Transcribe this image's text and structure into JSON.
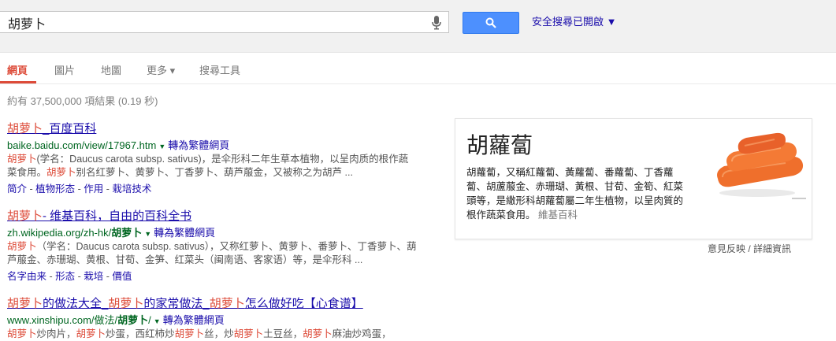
{
  "search": {
    "query": "胡萝卜",
    "button_icon": "search-icon",
    "mic_icon": "microphone-icon"
  },
  "safesearch": {
    "label": "安全搜尋已開啟 ▼"
  },
  "tabs": [
    {
      "label": "網頁",
      "active": true
    },
    {
      "label": "圖片"
    },
    {
      "label": "地圖"
    },
    {
      "label": "更多 ▾"
    },
    {
      "label": "搜尋工具"
    }
  ],
  "stats": "約有 37,500,000 項結果 (0.19 秒)",
  "results": [
    {
      "title_hl": "胡萝卜",
      "title_rest": "_百度百科",
      "url": "baike.baidu.com/view/17967.htm",
      "translate": "轉為繁體網頁",
      "snippet": [
        {
          "hl": "胡萝卜"
        },
        {
          "t": "(学名：Daucus carota subsp. sativus)，是伞形科二年生草本植物，以呈肉质的根作蔬菜食用。"
        },
        {
          "hl": "胡萝卜"
        },
        {
          "t": "别名红萝卜、黄萝卜、丁香萝卜、葫芦菔金，又被称之为胡芦 ..."
        }
      ],
      "links": [
        "简介",
        "植物形态",
        "作用",
        "栽培技术"
      ]
    },
    {
      "title_hl": "胡萝卜",
      "title_rest": "- 维基百科，自由的百科全书",
      "url_pre": "zh.wikipedia.org/zh-hk/",
      "url_bold": "胡萝卜",
      "translate": "轉為繁體網頁",
      "snippet": [
        {
          "hl": "胡萝卜"
        },
        {
          "t": "（学名：Daucus carota subsp. sativus），又称红萝卜、黄萝卜、番萝卜、丁香萝卜、葫芦菔金、赤珊瑚、黄根、甘荀、金笋、红菜头（闽南语、客家语）等，是伞形科 ..."
        }
      ],
      "links": [
        "名字由来",
        "形态",
        "栽培",
        "價值"
      ]
    },
    {
      "title_segments": [
        {
          "hl": "胡萝卜"
        },
        {
          "t": "的做法大全_"
        },
        {
          "hl": "胡萝卜"
        },
        {
          "t": "的家常做法_"
        },
        {
          "hl": "胡萝卜"
        },
        {
          "t": "怎么做好吃【心食谱】"
        }
      ],
      "url_pre": "www.xinshipu.com/做法/",
      "url_bold": "胡萝卜",
      "url_post": "/",
      "translate": "轉為繁體網頁",
      "snippet": [
        {
          "hl": "胡萝卜"
        },
        {
          "t": "炒肉片，"
        },
        {
          "hl": "胡萝卜"
        },
        {
          "t": "炒蛋，西红柿炒"
        },
        {
          "hl": "胡萝卜"
        },
        {
          "t": "丝，炒"
        },
        {
          "hl": "胡萝卜"
        },
        {
          "t": "土豆丝，"
        },
        {
          "hl": "胡萝卜"
        },
        {
          "t": "麻油炒鸡蛋，"
        }
      ]
    }
  ],
  "knowledge_panel": {
    "title": "胡蘿蔔",
    "description": "胡蘿蔔，又稱紅蘿蔔、黃蘿蔔、番蘿蔔、丁香蘿蔔、胡蘆菔金、赤珊瑚、黃根、甘荀、金筍、紅菜頭等，是繖形科胡蘿蔔屬二年生植物，以呈肉質的根作蔬菜食用。",
    "source": "維基百科",
    "image": "carrots-image"
  },
  "feedback": "意見反映 / 詳細資訊",
  "colors": {
    "accent": "#dd4b39",
    "link": "#1a0dab",
    "url": "#006621",
    "button": "#4d90fe"
  }
}
